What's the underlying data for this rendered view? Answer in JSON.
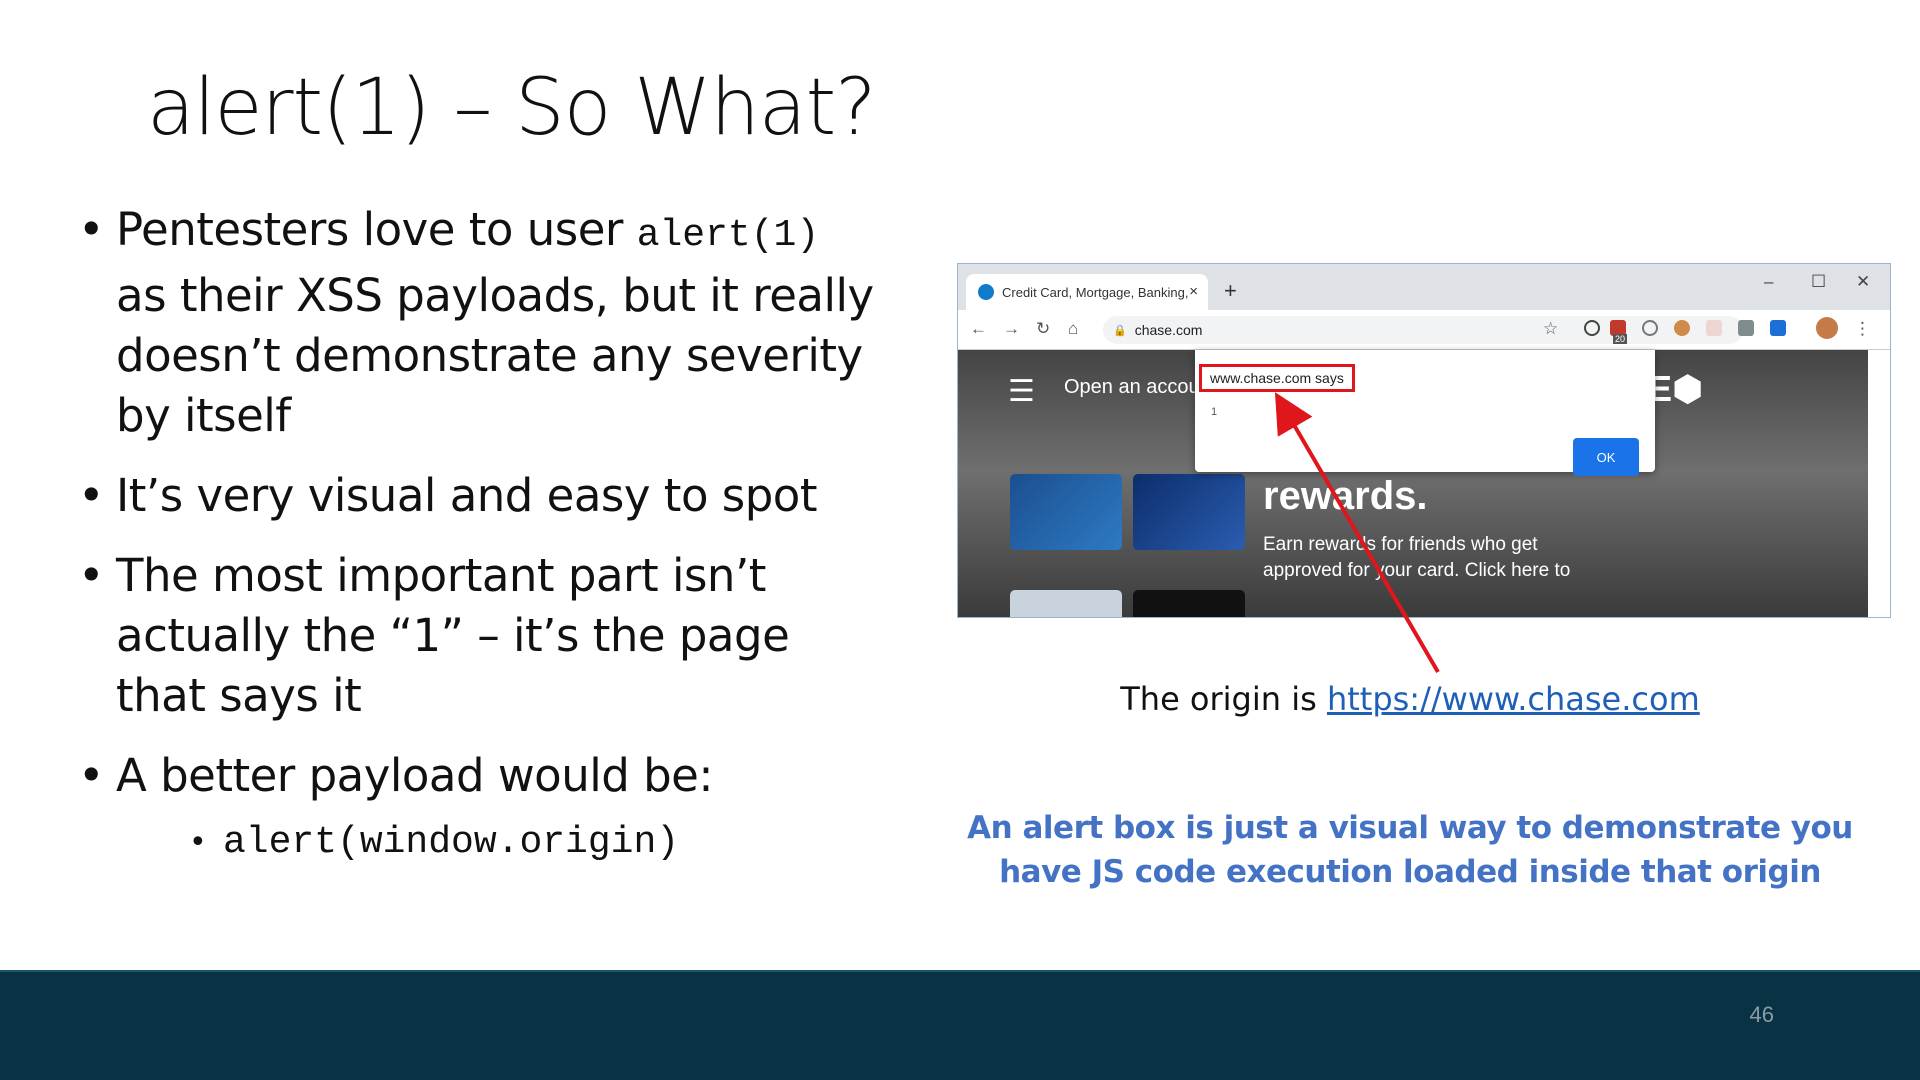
{
  "slide": {
    "title": "alert(1) – So What?",
    "bullets": {
      "b1_text": "Pentesters love to user ",
      "b1_code": "alert(1)",
      "b1_rest": " as their XSS payloads, but it really doesn’t demonstrate any severity by itself",
      "b2": "It’s very visual and easy to spot",
      "b3": "The most important part isn’t actually the “1” – it’s the page that says it",
      "b4": "A better payload would be:",
      "b4_sub": "alert(window.origin)"
    },
    "origin_prefix": "The origin is ",
    "origin_link": "https://www.chase.com",
    "note": "An alert box is just a visual way to demonstrate you have JS code execution loaded inside that origin",
    "page_number": "46"
  },
  "screenshot": {
    "tab_title": "Credit Card, Mortgage, Banking,",
    "tab_close": "×",
    "new_tab": "+",
    "url": "chase.com",
    "win_min": "–",
    "win_max": "☐",
    "win_close": "✕",
    "menu_label": "Open an accou",
    "rewards": "rewards.",
    "earn_line1": "Earn rewards for friends who get",
    "earn_line2": "approved for your card. Click here to",
    "dialog_host": "www.chase.com says",
    "dialog_message": "1",
    "dialog_ok": "OK",
    "badge_count": "20"
  },
  "colors": {
    "accent_blue": "#4472c4",
    "footer": "#093344",
    "highlight_red": "#e0161d",
    "link": "#1f5fb8"
  }
}
